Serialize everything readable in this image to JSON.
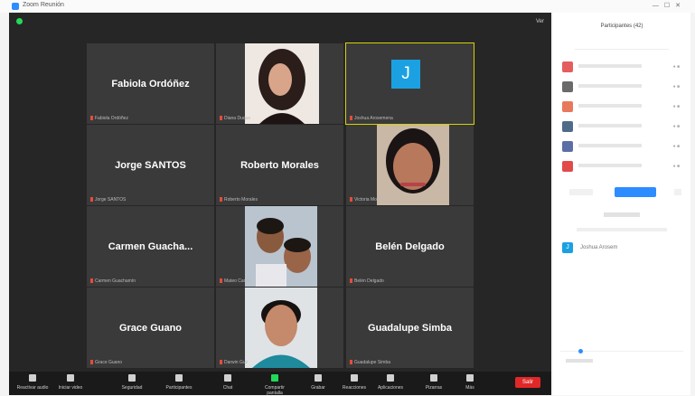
{
  "window": {
    "title": "Zoom Reunión"
  },
  "colors": {
    "accent": "#2d8cff",
    "active_speaker": "#d6d200",
    "end": "#e02828",
    "tile_bg": "#3a3a3a",
    "avatar_j": "#1ba1e2"
  },
  "top": {
    "view_label": "Ver"
  },
  "tiles": [
    {
      "name": "Fabiola Ordóñez",
      "label": "Fabiola Ordóñez"
    },
    {
      "name": "",
      "label": "Diana Duque"
    },
    {
      "name": "",
      "initial": "J",
      "label": "Joshua Arosemena"
    },
    {
      "name": "Jorge SANTOS",
      "label": "Jorge SANTOS"
    },
    {
      "name": "Roberto Morales",
      "label": "Roberto Morales"
    },
    {
      "name": "",
      "label": "Victoria Morales"
    },
    {
      "name": "Carmen  Guacha...",
      "label": "Carmen Guachamín"
    },
    {
      "name": "",
      "label": "Mateo Cando"
    },
    {
      "name": "Belén Delgado",
      "label": "Belén Delgado"
    },
    {
      "name": "Grace Guano",
      "label": "Grace Guano"
    },
    {
      "name": "",
      "label": "Darwin Guz"
    },
    {
      "name": "Guadalupe Simba",
      "label": "Guadalupe Simba"
    }
  ],
  "toolbar": {
    "items": [
      "Reactivar audio",
      "Iniciar video",
      "Seguridad",
      "Participantes",
      "Chat",
      "Compartir pantalla",
      "Grabar",
      "Reacciones",
      "Aplicaciones",
      "Pizarras",
      "Más"
    ],
    "end_label": "Salir"
  },
  "participants": {
    "title": "Participantes (42)",
    "chat_from_initial": "J",
    "chat_from_name": "Joshua Arosem"
  }
}
